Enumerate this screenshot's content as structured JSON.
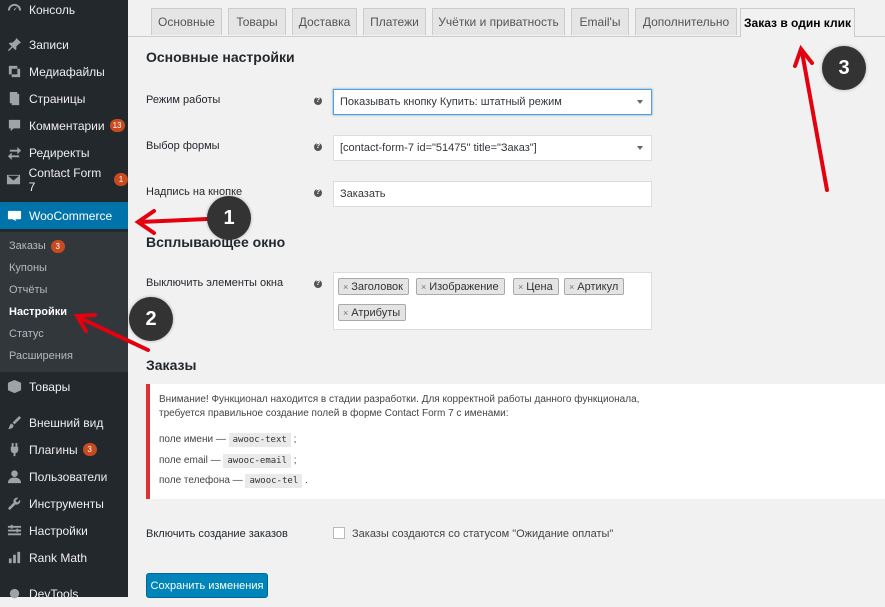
{
  "sidebar": {
    "items": [
      {
        "label": "Консоль",
        "icon": "dashboard-icon"
      },
      {
        "label": "Записи",
        "icon": "pin-icon"
      },
      {
        "label": "Медиафайлы",
        "icon": "media-icon"
      },
      {
        "label": "Страницы",
        "icon": "page-icon"
      },
      {
        "label": "Комментарии",
        "icon": "comment-icon",
        "badge": "13"
      },
      {
        "label": "Редиректы",
        "icon": "redirect-icon"
      },
      {
        "label": "Contact Form 7",
        "icon": "mail-icon",
        "badge": "1"
      },
      {
        "label": "WooCommerce",
        "icon": "woo-icon"
      },
      {
        "label": "Товары",
        "icon": "box-icon"
      },
      {
        "label": "Внешний вид",
        "icon": "brush-icon"
      },
      {
        "label": "Плагины",
        "icon": "plugin-icon",
        "badge": "3"
      },
      {
        "label": "Пользователи",
        "icon": "user-icon"
      },
      {
        "label": "Инструменты",
        "icon": "wrench-icon"
      },
      {
        "label": "Настройки",
        "icon": "settings-icon"
      },
      {
        "label": "Rank Math",
        "icon": "chart-icon"
      },
      {
        "label": "DevTools",
        "icon": "gear-icon"
      }
    ],
    "submenu": [
      {
        "label": "Заказы",
        "badge": "3"
      },
      {
        "label": "Купоны"
      },
      {
        "label": "Отчёты"
      },
      {
        "label": "Настройки"
      },
      {
        "label": "Статус"
      },
      {
        "label": "Расширения"
      }
    ]
  },
  "tabs": [
    "Основные",
    "Товары",
    "Доставка",
    "Платежи",
    "Учётки и приватность",
    "Email'ы",
    "Дополнительно",
    "Заказ в один клик"
  ],
  "sections": {
    "main_settings": "Основные настройки",
    "popup": "Всплывающее окно",
    "orders": "Заказы"
  },
  "fields": {
    "mode_label": "Режим работы",
    "mode_value": "Показывать кнопку Купить: штатный режим",
    "form_label": "Выбор формы",
    "form_value": "[contact-form-7 id=\"51475\" title=\"Заказ\"]",
    "button_label": "Надпись на кнопке",
    "button_value": "Заказать",
    "disable_label": "Выключить элементы окна",
    "chips": [
      "Заголовок",
      "Изображение",
      "Цена",
      "Артикул",
      "Атрибуты"
    ]
  },
  "notice": {
    "line1": "Внимание! Функционал находится в стадии разработки. Для корректной работы данного функционала,",
    "line2": "требуется правильное создание полей в форме Contact Form 7 с именами:",
    "name_label": "поле имени —",
    "name_code": "awooc-text",
    "name_end": ";",
    "email_label": "поле email —",
    "email_code": "awooc-email",
    "email_end": ";",
    "phone_label": "поле телефона —",
    "phone_code": "awooc-tel",
    "phone_end": "."
  },
  "create_orders": {
    "label": "Включить создание заказов",
    "checkbox_text": "Заказы создаются со статусом \"Ожидание оплаты\""
  },
  "save_button": "Сохранить изменения",
  "markers": [
    "1",
    "2",
    "3"
  ],
  "colors": {
    "sidebar": "#23282d",
    "submenu": "#32373c",
    "accent": "#0073aa",
    "badge": "#ca4a1f",
    "arrow": "#e3000f"
  }
}
